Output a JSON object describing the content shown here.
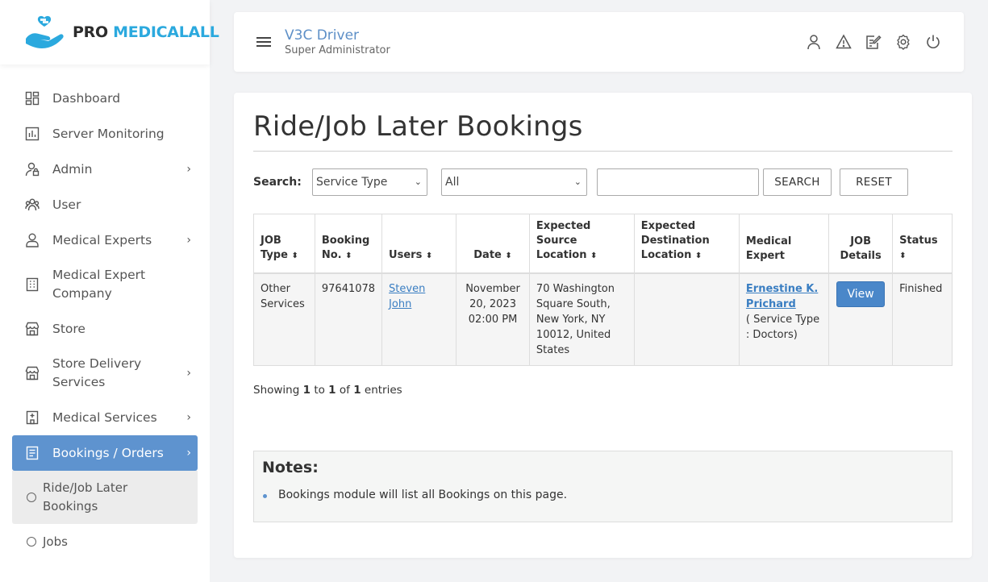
{
  "brand": {
    "pro": "PRO",
    "name": "MEDICALALL"
  },
  "sidebar": {
    "items": [
      {
        "label": "Dashboard",
        "icon": "dashboard-icon"
      },
      {
        "label": "Server Monitoring",
        "icon": "chart-icon"
      },
      {
        "label": "Admin",
        "icon": "admin-icon",
        "has_children": true
      },
      {
        "label": "User",
        "icon": "users-icon"
      },
      {
        "label": "Medical Experts",
        "icon": "person-icon",
        "has_children": true
      },
      {
        "label": "Medical Expert Company",
        "icon": "building-icon"
      },
      {
        "label": "Store",
        "icon": "store-icon"
      },
      {
        "label": "Store Delivery Services",
        "icon": "store-icon",
        "has_children": true
      },
      {
        "label": "Medical Services",
        "icon": "hospital-icon",
        "has_children": true
      },
      {
        "label": "Bookings / Orders",
        "icon": "document-icon",
        "has_children": true,
        "active": true
      }
    ],
    "sub_items": [
      {
        "label": "Ride/Job Later Bookings",
        "active": true
      },
      {
        "label": "Jobs"
      }
    ],
    "chevron": "›"
  },
  "header": {
    "user_name": "V3C Driver",
    "user_role": "Super Administrator",
    "icons": [
      "profile-icon",
      "alert-icon",
      "edit-note-icon",
      "settings-icon",
      "power-icon"
    ]
  },
  "page": {
    "title": "Ride/Job Later Bookings",
    "search_label": "Search:",
    "filter1_value": "Service Type",
    "filter2_value": "All",
    "search_text": "",
    "search_button": "SEARCH",
    "reset_button": "RESET"
  },
  "table": {
    "sort_glyph": "⬍",
    "headers": [
      {
        "lines": [
          "JOB",
          "Type"
        ],
        "sortable": true
      },
      {
        "lines": [
          "Booking",
          "No."
        ],
        "sortable": true
      },
      {
        "lines": [
          "Users"
        ],
        "sortable": true
      },
      {
        "lines": [
          "Date"
        ],
        "sortable": true
      },
      {
        "lines": [
          "Expected Source",
          "Location"
        ],
        "sortable": true
      },
      {
        "lines": [
          "Expected",
          "Destination",
          "Location"
        ],
        "sortable": true
      },
      {
        "lines": [
          "Medical",
          "Expert"
        ],
        "sortable": false
      },
      {
        "lines": [
          "JOB",
          "Details"
        ],
        "sortable": false
      },
      {
        "lines": [
          "Status"
        ],
        "sortable": true
      }
    ],
    "rows": [
      {
        "job_type": "Other Services",
        "booking_no": "97641078",
        "user": "Steven John",
        "date_line1": "November",
        "date_line2": "20, 2023",
        "date_line3": "02:00 PM",
        "source": "70 Washington Square South, New York, NY 10012, United States",
        "destination": "",
        "expert_name": "Ernestine K. Prichard",
        "expert_note": "( Service Type : Doctors)",
        "details_button": "View",
        "status": "Finished"
      }
    ]
  },
  "pagination": {
    "prefix": "Showing",
    "from": "1",
    "to_word": "to",
    "to": "1",
    "of_word": "of",
    "total": "1",
    "suffix": "entries"
  },
  "notes": {
    "title": "Notes:",
    "items": [
      "Bookings module will list all Bookings on this page."
    ]
  },
  "colors": {
    "accent": "#5e93cf",
    "brand_blue": "#2ba9de",
    "link": "#3a7ec2",
    "view_button": "#4a87c9"
  }
}
